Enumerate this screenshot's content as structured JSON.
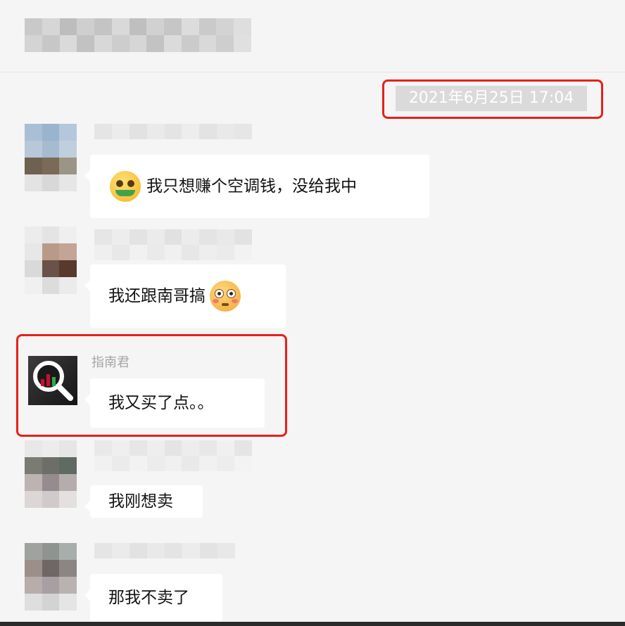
{
  "chat": {
    "timestamp": "2021年6月25日 17:04",
    "messages": [
      {
        "sender": "",
        "text": "我只想赚个空调钱，没给我中",
        "emoji": "money-mouth-face-icon"
      },
      {
        "sender": "",
        "text": "我还跟南哥搞",
        "emoji": "flushed-face-icon"
      },
      {
        "sender": "指南君",
        "text": "我又买了点。。",
        "avatar_icon": "magnifier-bar-chart-icon"
      },
      {
        "sender": "",
        "text": "我刚想卖"
      },
      {
        "sender": "",
        "text": "那我不卖了"
      }
    ]
  },
  "colors": {
    "highlight": "#e8201a",
    "background": "#f5f5f5",
    "bubble": "#ffffff",
    "timestamp_bg": "#dadada"
  }
}
